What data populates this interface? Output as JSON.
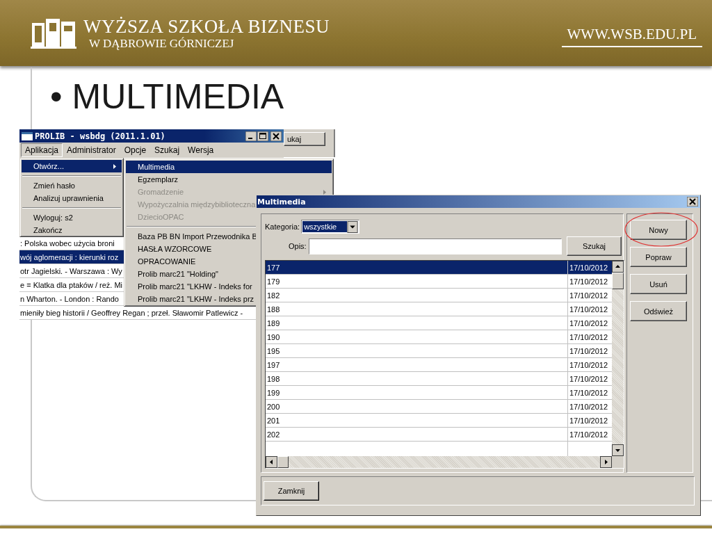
{
  "header": {
    "school_name": "WYŻSZA SZKOŁA BIZNESU",
    "school_subtitle": "W DĄBROWIE GÓRNICZEJ",
    "url": "WWW.WSB.EDU.PL"
  },
  "slide": {
    "bullet": "•",
    "title": "MULTIMEDIA"
  },
  "main_window": {
    "title": "PROLIB - wsbdg (2011.1.01)",
    "menu": [
      {
        "label": "Aplikacja",
        "selected": true
      },
      {
        "label": "Administrator",
        "selected": false
      },
      {
        "label": "Opcje",
        "selected": false
      },
      {
        "label": "Szukaj",
        "selected": false
      },
      {
        "label": "Wersja",
        "selected": false
      }
    ],
    "background_button": "ukaj",
    "rows": [
      {
        "text": ": Polska wobec użycia broni",
        "selected": false
      },
      {
        "text": "wój aglomeracji : kierunki roz",
        "selected": true
      },
      {
        "text": "otr Jagielski. - Warszawa : Wy",
        "selected": false
      },
      {
        "text": "e = Klatka dla ptaków / reż. Mi",
        "selected": false
      },
      {
        "text": "n Wharton. - London :  Rando",
        "selected": false
      },
      {
        "text": "mieniły bieg historii / Geoffrey Regan ; przeł. Sławomir Patlewicz  -",
        "selected": false
      }
    ]
  },
  "app_menu": [
    {
      "kind": "item",
      "label": "Otwórz...",
      "selected": true,
      "has_submenu": true
    },
    {
      "kind": "separator"
    },
    {
      "kind": "item",
      "label": "Zmień hasło",
      "selected": false,
      "has_submenu": false
    },
    {
      "kind": "item",
      "label": "Analizuj uprawnienia",
      "selected": false,
      "has_submenu": false
    },
    {
      "kind": "separator"
    },
    {
      "kind": "item",
      "label": "Wyloguj: s2",
      "selected": false,
      "has_submenu": false
    },
    {
      "kind": "item",
      "label": "Zakończ",
      "selected": false,
      "has_submenu": false
    }
  ],
  "submenu": [
    {
      "kind": "item",
      "label": "Multimedia",
      "selected": true,
      "disabled": false,
      "has_submenu": false
    },
    {
      "kind": "item",
      "label": "Egzemplarz",
      "selected": false,
      "disabled": false,
      "has_submenu": false
    },
    {
      "kind": "item",
      "label": "Gromadzenie",
      "selected": false,
      "disabled": true,
      "has_submenu": true
    },
    {
      "kind": "item",
      "label": "Wypożyczalnia międzybiblioteczna",
      "selected": false,
      "disabled": true,
      "has_submenu": false
    },
    {
      "kind": "item",
      "label": "DziecioOPAC",
      "selected": false,
      "disabled": true,
      "has_submenu": false
    },
    {
      "kind": "separator"
    },
    {
      "kind": "item",
      "label": "Baza PB BN Import Przewodnika B",
      "selected": false,
      "disabled": false
    },
    {
      "kind": "item",
      "label": "HASŁA WZORCOWE",
      "selected": false,
      "disabled": false
    },
    {
      "kind": "item",
      "label": "OPRACOWANIE",
      "selected": false,
      "disabled": false
    },
    {
      "kind": "item",
      "label": "Prolib marc21 \"Holding\"",
      "selected": false,
      "disabled": false
    },
    {
      "kind": "item",
      "label": "Prolib marc21 \"LKHW - Indeks for",
      "selected": false,
      "disabled": false
    },
    {
      "kind": "item",
      "label": "Prolib marc21 \"LKHW - Indeks prz",
      "selected": false,
      "disabled": false
    }
  ],
  "dialog": {
    "title": "Multimedia",
    "category_label": "Kategoria:",
    "category_value": "wszystkie",
    "search_label": "Opis:",
    "search_button": "Szukaj",
    "rows": [
      {
        "id": "177",
        "date": "17/10/2012",
        "selected": true
      },
      {
        "id": "179",
        "date": "17/10/2012",
        "selected": false
      },
      {
        "id": "182",
        "date": "17/10/2012",
        "selected": false
      },
      {
        "id": "188",
        "date": "17/10/2012",
        "selected": false
      },
      {
        "id": "189",
        "date": "17/10/2012",
        "selected": false
      },
      {
        "id": "190",
        "date": "17/10/2012",
        "selected": false
      },
      {
        "id": "195",
        "date": "17/10/2012",
        "selected": false
      },
      {
        "id": "197",
        "date": "17/10/2012",
        "selected": false
      },
      {
        "id": "198",
        "date": "17/10/2012",
        "selected": false
      },
      {
        "id": "199",
        "date": "17/10/2012",
        "selected": false
      },
      {
        "id": "200",
        "date": "17/10/2012",
        "selected": false
      },
      {
        "id": "201",
        "date": "17/10/2012",
        "selected": false
      },
      {
        "id": "202",
        "date": "17/10/2012",
        "selected": false
      }
    ],
    "side_buttons": [
      {
        "label": "Nowy",
        "circled": true
      },
      {
        "label": "Popraw",
        "circled": false
      },
      {
        "label": "Usuń",
        "circled": false
      },
      {
        "label": "Odśwież",
        "circled": false
      }
    ],
    "close_button": "Zamknij"
  }
}
